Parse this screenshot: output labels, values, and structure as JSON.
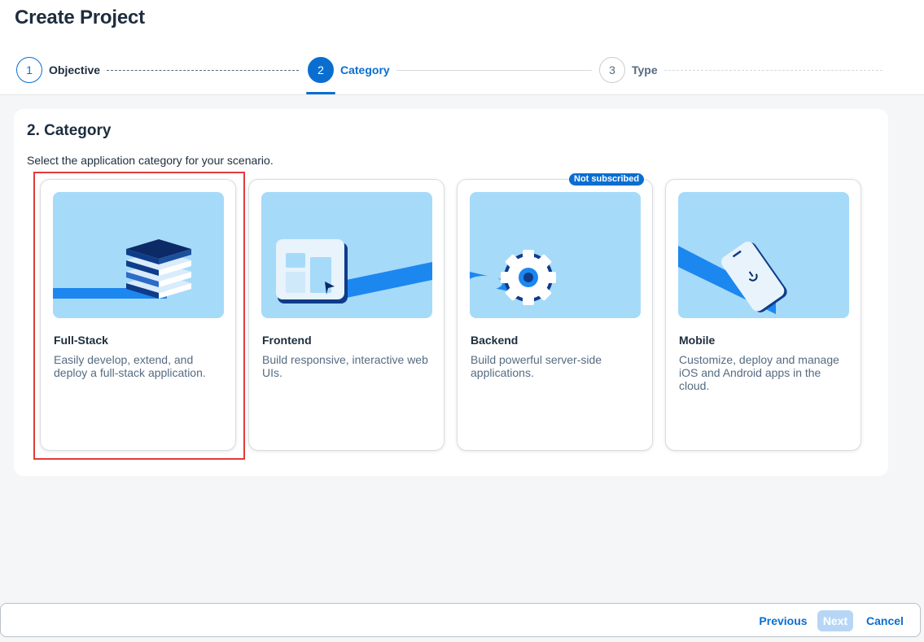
{
  "page": {
    "title": "Create Project"
  },
  "wizard": {
    "steps": [
      {
        "number": "1",
        "label": "Objective",
        "state": "completed"
      },
      {
        "number": "2",
        "label": "Category",
        "state": "active"
      },
      {
        "number": "3",
        "label": "Type",
        "state": "upcoming"
      }
    ]
  },
  "section": {
    "title": "2. Category",
    "instruction": "Select the application category for your scenario."
  },
  "cards": [
    {
      "title": "Full-Stack",
      "description": "Easily develop, extend, and deploy a full-stack application.",
      "illustration": "stack-layers-icon"
    },
    {
      "title": "Frontend",
      "description": "Build responsive, interactive web UIs.",
      "illustration": "web-ui-window-icon"
    },
    {
      "title": "Backend",
      "description": "Build powerful server-side applications.",
      "illustration": "gear-icon",
      "badge": "Not subscribed"
    },
    {
      "title": "Mobile",
      "description": "Customize, deploy and manage iOS and Android apps in the cloud.",
      "illustration": "mobile-phone-icon"
    }
  ],
  "footer": {
    "previous": "Previous",
    "next": "Next",
    "cancel": "Cancel"
  },
  "colors": {
    "accent": "#0a6ed1",
    "illustration_bg": "#a6daf9",
    "highlight": "#e03b3b",
    "text": "#1d2d3e",
    "muted": "#556b82"
  }
}
